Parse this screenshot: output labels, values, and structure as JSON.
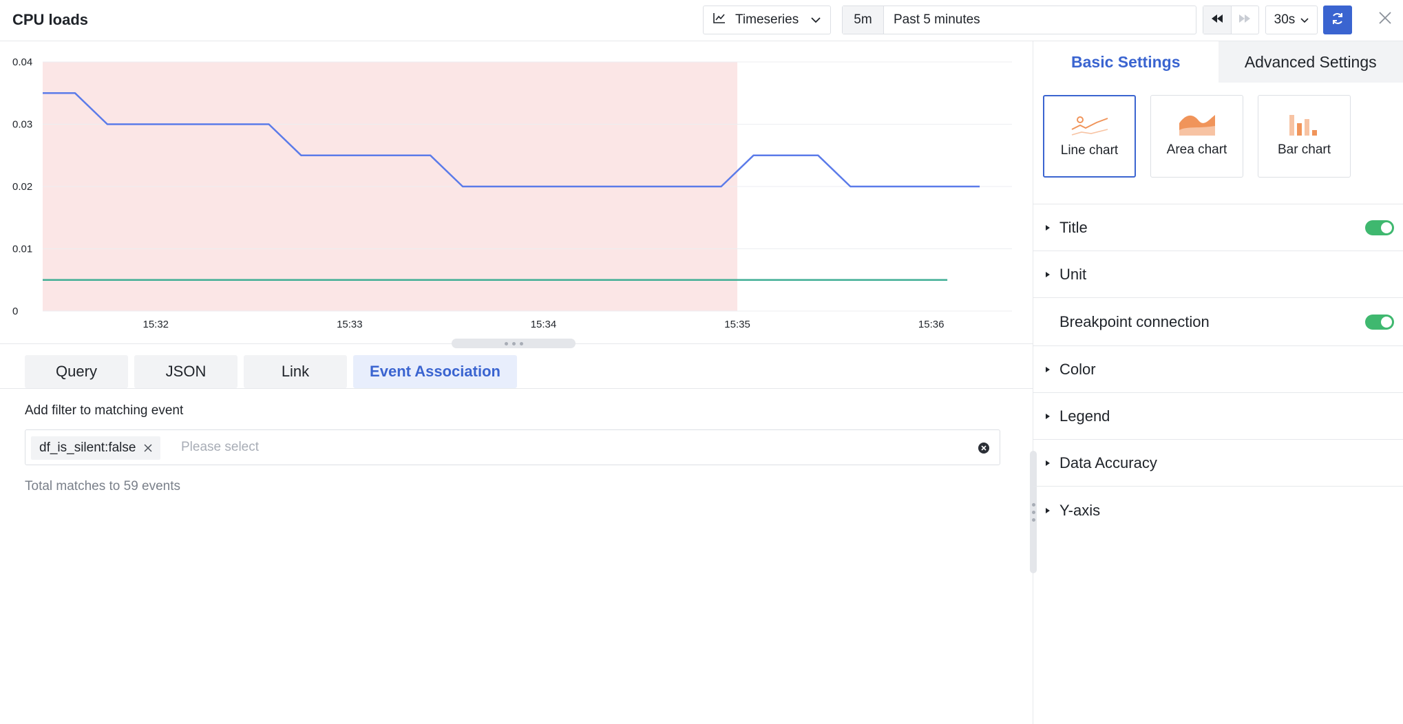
{
  "header": {
    "title": "CPU loads",
    "viz_type": "Timeseries",
    "time_short": "5m",
    "time_range": "Past 5 minutes",
    "refresh_interval": "30s"
  },
  "chart_data": {
    "type": "line",
    "x": [
      "15:31:25",
      "15:31:35",
      "15:31:45",
      "15:31:55",
      "15:32:05",
      "15:32:15",
      "15:32:25",
      "15:32:35",
      "15:32:45",
      "15:32:55",
      "15:33:05",
      "15:33:15",
      "15:33:25",
      "15:33:35",
      "15:33:45",
      "15:33:55",
      "15:34:05",
      "15:34:15",
      "15:34:25",
      "15:34:35",
      "15:34:45",
      "15:34:55",
      "15:35:05",
      "15:35:15",
      "15:35:25",
      "15:35:35",
      "15:35:45",
      "15:35:55",
      "15:36:05",
      "15:36:15"
    ],
    "series": [
      {
        "values": [
          0.035,
          0.035,
          0.03,
          0.03,
          0.03,
          0.03,
          0.03,
          0.03,
          0.025,
          0.025,
          0.025,
          0.025,
          0.025,
          0.02,
          0.02,
          0.02,
          0.02,
          0.02,
          0.02,
          0.02,
          0.02,
          0.02,
          0.025,
          0.025,
          0.025,
          0.02,
          0.02,
          0.02,
          0.02,
          0.02
        ],
        "color": "#5b7be9"
      },
      {
        "values": [
          0.005,
          0.005,
          0.005,
          0.005,
          0.005,
          0.005,
          0.005,
          0.005,
          0.005,
          0.005,
          0.005,
          0.005,
          0.005,
          0.005,
          0.005,
          0.005,
          0.005,
          0.005,
          0.005,
          0.005,
          0.005,
          0.005,
          0.005,
          0.005,
          0.005,
          0.005,
          0.005,
          0.005,
          0.005
        ],
        "color": "#3fae94"
      }
    ],
    "x_ticks": [
      "15:32",
      "15:33",
      "15:34",
      "15:35",
      "15:36"
    ],
    "y_ticks": [
      "0",
      "0.01",
      "0.02",
      "0.03",
      "0.04"
    ],
    "ylim": [
      0,
      0.04
    ],
    "xlim": [
      "15:31:25",
      "15:36:25"
    ],
    "highlight_range": [
      "15:31:25",
      "15:35:00"
    ],
    "highlight_color": "#fbe6e6",
    "grid": true
  },
  "tabs": [
    {
      "label": "Query",
      "active": false
    },
    {
      "label": "JSON",
      "active": false
    },
    {
      "label": "Link",
      "active": false
    },
    {
      "label": "Event Association",
      "active": true
    }
  ],
  "event_filter": {
    "label": "Add filter to matching event",
    "tag": "df_is_silent:false",
    "placeholder": "Please select",
    "match_count_text": "Total matches to 59 events"
  },
  "right_panel": {
    "tabs": [
      {
        "label": "Basic Settings",
        "active": true
      },
      {
        "label": "Advanced Settings",
        "active": false
      }
    ],
    "chart_types": [
      {
        "label": "Line chart",
        "icon": "line-chart-icon",
        "active": true
      },
      {
        "label": "Area chart",
        "icon": "area-chart-icon",
        "active": false
      },
      {
        "label": "Bar chart",
        "icon": "bar-chart-icon",
        "active": false
      }
    ],
    "sections": [
      {
        "label": "Title",
        "toggle": true,
        "expandable": true
      },
      {
        "label": "Unit",
        "toggle": false,
        "expandable": true
      },
      {
        "label": "Breakpoint connection",
        "toggle": true,
        "expandable": false
      },
      {
        "label": "Color",
        "toggle": false,
        "expandable": true
      },
      {
        "label": "Legend",
        "toggle": false,
        "expandable": true
      },
      {
        "label": "Data Accuracy",
        "toggle": false,
        "expandable": true
      },
      {
        "label": "Y-axis",
        "toggle": false,
        "expandable": true
      }
    ]
  },
  "colors": {
    "accent": "#3a64d0",
    "toggle_on": "#3fb86f",
    "chart_icon_orange": "#f0945a"
  }
}
